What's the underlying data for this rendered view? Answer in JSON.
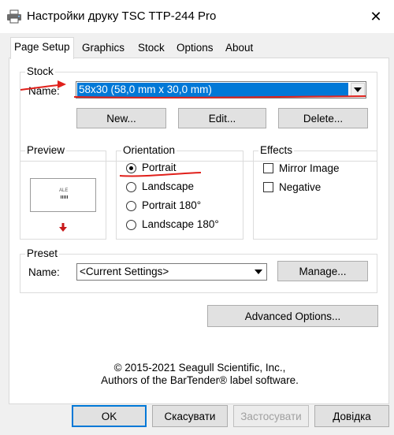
{
  "window": {
    "title": "Настройки друку TSC TTP-244 Pro"
  },
  "tabs": [
    {
      "label": "Page Setup",
      "active": true
    },
    {
      "label": "Graphics",
      "active": false
    },
    {
      "label": "Stock",
      "active": false
    },
    {
      "label": "Options",
      "active": false
    },
    {
      "label": "About",
      "active": false
    }
  ],
  "stock": {
    "group_label": "Stock",
    "name_label": "Name:",
    "name_value": "58x30 (58,0 mm x 30,0 mm)",
    "new_button": "New...",
    "edit_button": "Edit...",
    "delete_button": "Delete..."
  },
  "preview": {
    "group_label": "Preview",
    "sample_text": "ALE"
  },
  "orientation": {
    "group_label": "Orientation",
    "options": [
      {
        "label": "Portrait",
        "selected": true
      },
      {
        "label": "Landscape",
        "selected": false
      },
      {
        "label": "Portrait 180°",
        "selected": false
      },
      {
        "label": "Landscape 180°",
        "selected": false
      }
    ]
  },
  "effects": {
    "group_label": "Effects",
    "options": [
      {
        "label": "Mirror Image",
        "checked": false
      },
      {
        "label": "Negative",
        "checked": false
      }
    ]
  },
  "preset": {
    "group_label": "Preset",
    "name_label": "Name:",
    "name_value": "<Current Settings>",
    "manage_button": "Manage..."
  },
  "advanced_button": "Advanced Options...",
  "copyright": {
    "line1": "© 2015-2021 Seagull Scientific, Inc.,",
    "line2": "Authors of the BarTender® label software."
  },
  "footer": {
    "ok": "OK",
    "cancel": "Скасувати",
    "apply": "Застосувати",
    "help": "Довідка"
  },
  "colors": {
    "selection": "#0078d7",
    "annotation": "#e0201b"
  }
}
